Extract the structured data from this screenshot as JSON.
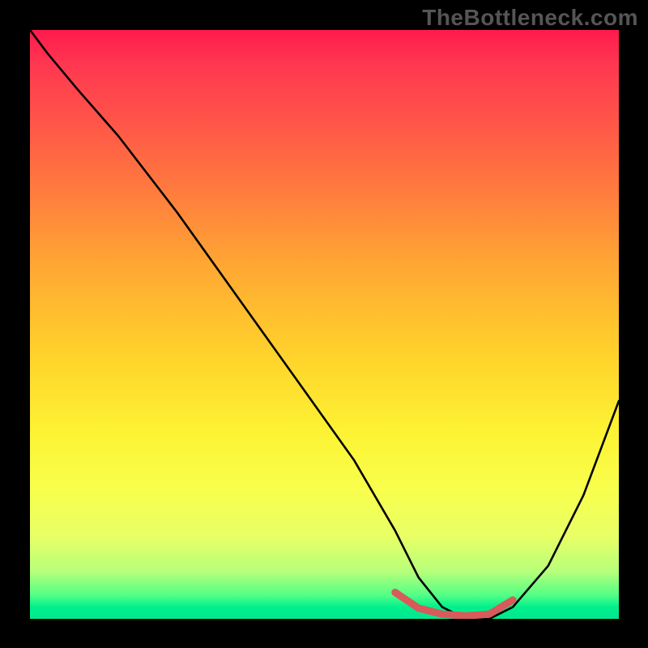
{
  "watermark": "TheBottleneck.com",
  "gradient_colors": {
    "top": "#ff1a4d",
    "mid_upper": "#ff7a3e",
    "mid": "#ffd22b",
    "mid_lower": "#f8ff4c",
    "bottom": "#00e890"
  },
  "chart_data": {
    "type": "line",
    "title": "",
    "xlabel": "",
    "ylabel": "",
    "xlim": [
      0,
      100
    ],
    "ylim": [
      0,
      100
    ],
    "series": [
      {
        "name": "bottleneck-curve",
        "color": "#000000",
        "x": [
          0,
          3,
          8,
          15,
          25,
          35,
          45,
          55,
          62,
          66,
          70,
          74,
          78,
          82,
          88,
          94,
          100
        ],
        "y": [
          100,
          96,
          90,
          82,
          69,
          55,
          41,
          27,
          15,
          7,
          2,
          0,
          0,
          2,
          9,
          21,
          37
        ]
      },
      {
        "name": "bottleneck-highlight",
        "color": "#d85a5a",
        "x": [
          62,
          66,
          70,
          74,
          78,
          82
        ],
        "y": [
          4.5,
          1.8,
          0.8,
          0.5,
          0.8,
          3.2
        ]
      }
    ]
  }
}
